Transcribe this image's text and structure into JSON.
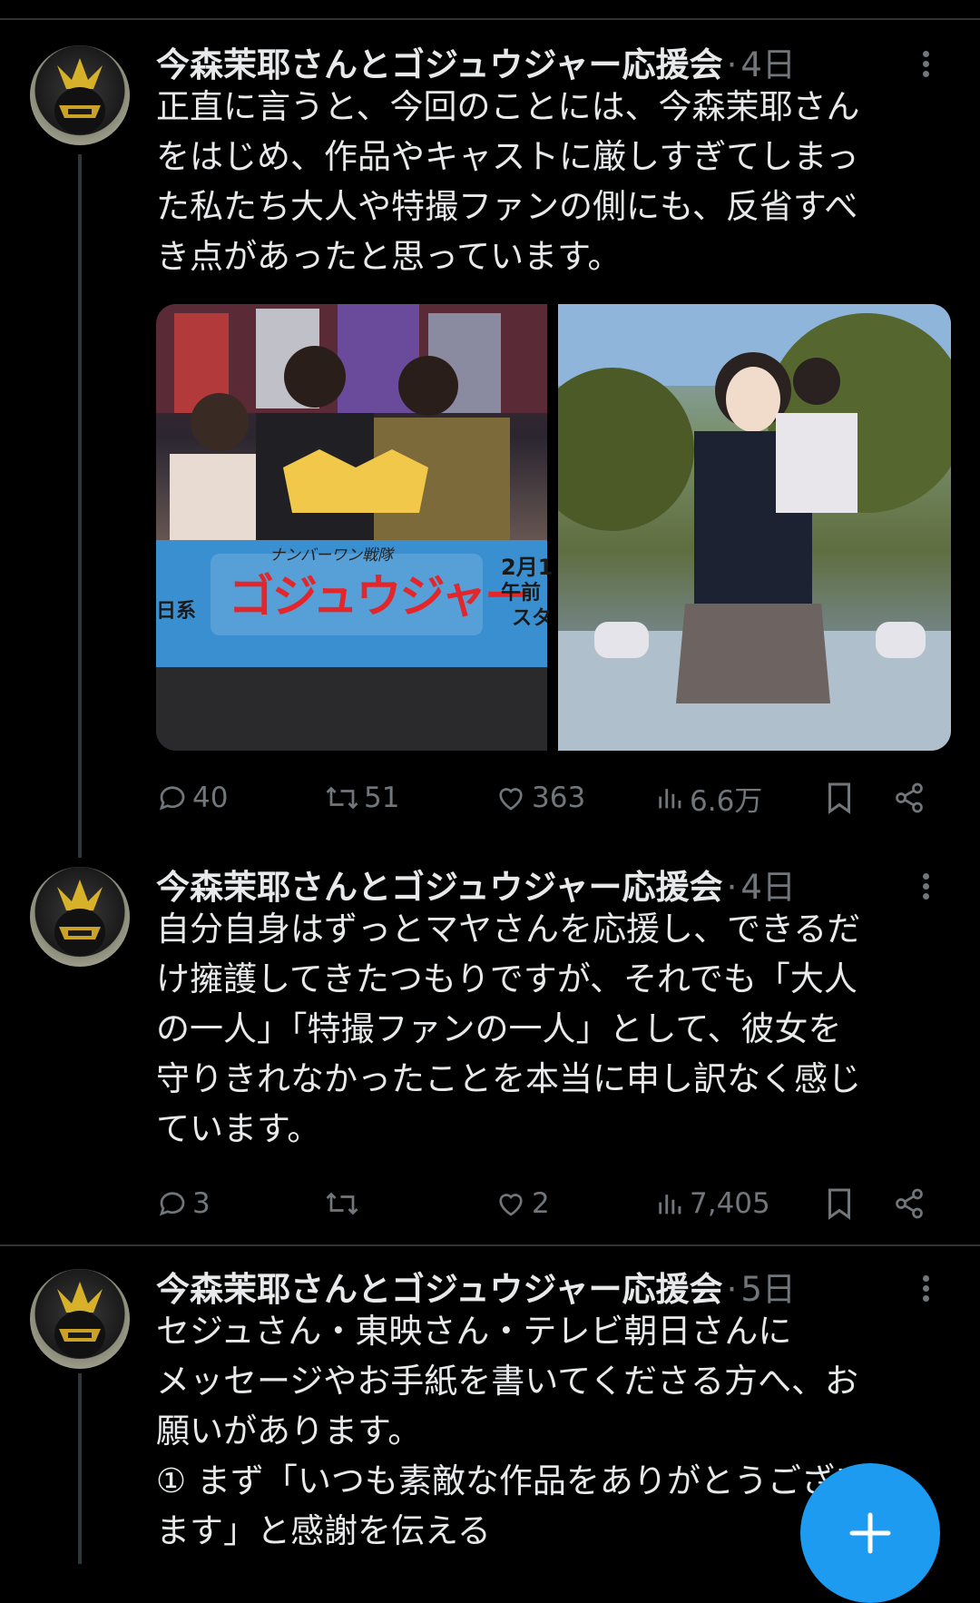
{
  "tweets": [
    {
      "author": "今森茉耶さんとゴジュウジャー応援会",
      "separator": "·",
      "time": "4日",
      "lines": [
        "正直に言うと、今回のことには、今森茉耶さん",
        "をはじめ、作品やキャストに厳しすぎてしまっ",
        "た私たち大人や特撮ファンの側にも、反省すべ",
        "き点があったと思っています。"
      ],
      "media_text": {
        "banner_small": "ナンバーワン戦隊",
        "banner_title": "ゴジュウジャー",
        "banner_date": "2月1",
        "banner_time": "午前",
        "banner_right": "スタ",
        "banner_left": "日系"
      },
      "stats": {
        "replies": "40",
        "reposts": "51",
        "likes": "363",
        "views": "6.6万"
      }
    },
    {
      "author": "今森茉耶さんとゴジュウジャー応援会",
      "separator": "·",
      "time": "4日",
      "lines": [
        "自分自身はずっとマヤさんを応援し、できるだ",
        "け擁護してきたつもりですが、それでも「大人",
        "の一人」「特撮ファンの一人」として、彼女を",
        "守りきれなかったことを本当に申し訳なく感じ",
        "ています。"
      ],
      "stats": {
        "replies": "3",
        "reposts": "",
        "likes": "2",
        "views": "7,405"
      }
    },
    {
      "author": "今森茉耶さんとゴジュウジャー応援会",
      "separator": "·",
      "time": "5日",
      "lines": [
        "セジュさん・東映さん・テレビ朝日さんに",
        "メッセージやお手紙を書いてくださる方へ、お",
        "願いがあります。",
        "① まず「いつも素敵な作品をありがとうござい",
        "ます」と感謝を伝える"
      ]
    }
  ],
  "icons": {
    "reply": "reply-icon",
    "repost": "repost-icon",
    "like": "heart-icon",
    "views": "views-icon",
    "bookmark": "bookmark-icon",
    "share": "share-icon",
    "more": "more-icon",
    "compose": "plus-icon"
  },
  "colors": {
    "background": "#000000",
    "text": "#e7e9ea",
    "muted": "#71767b",
    "accent": "#1d9bf0",
    "divider": "#2f3336"
  }
}
